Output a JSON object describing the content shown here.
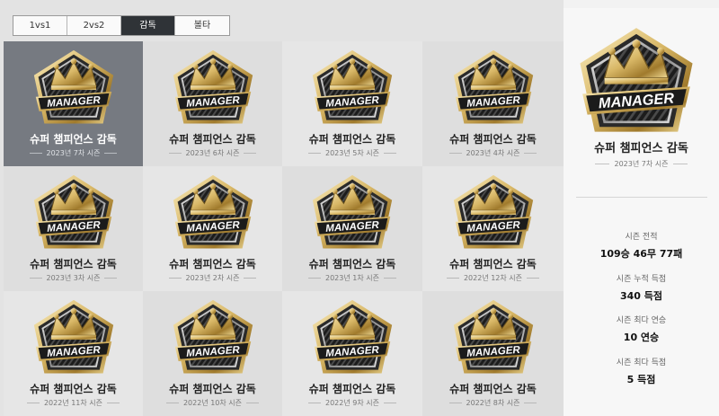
{
  "tabs": [
    {
      "label": "1vs1",
      "active": false
    },
    {
      "label": "2vs2",
      "active": false
    },
    {
      "label": "감독",
      "active": true
    },
    {
      "label": "볼타",
      "active": false
    }
  ],
  "badge": {
    "text": "MANAGER",
    "icon": "crown-icon",
    "colors": {
      "gold": "#d8b766",
      "dark": "#262626",
      "selected_bg": "#767a81"
    }
  },
  "cards": [
    {
      "title": "슈퍼 챔피언스 감독",
      "season": "2023년 7차 시즌",
      "selected": true
    },
    {
      "title": "슈퍼 챔피언스 감독",
      "season": "2023년 6차 시즌"
    },
    {
      "title": "슈퍼 챔피언스 감독",
      "season": "2023년 5차 시즌"
    },
    {
      "title": "슈퍼 챔피언스 감독",
      "season": "2023년 4차 시즌"
    },
    {
      "title": "슈퍼 챔피언스 감독",
      "season": "2023년 3차 시즌"
    },
    {
      "title": "슈퍼 챔피언스 감독",
      "season": "2023년 2차 시즌"
    },
    {
      "title": "슈퍼 챔피언스 감독",
      "season": "2023년 1차 시즌"
    },
    {
      "title": "슈퍼 챔피언스 감독",
      "season": "2022년 12차 시즌"
    },
    {
      "title": "슈퍼 챔피언스 감독",
      "season": "2022년 11차 시즌"
    },
    {
      "title": "슈퍼 챔피언스 감독",
      "season": "2022년 10차 시즌"
    },
    {
      "title": "슈퍼 챔피언스 감독",
      "season": "2022년 9차 시즌"
    },
    {
      "title": "슈퍼 챔피언스 감독",
      "season": "2022년 8차 시즌"
    }
  ],
  "detail": {
    "title": "슈퍼 챔피언스 감독",
    "season": "2023년 7차 시즌",
    "stats": [
      {
        "label": "시즌 전적",
        "value": "109승 46무 77패"
      },
      {
        "label": "시즌 누적 득점",
        "value": "340 득점"
      },
      {
        "label": "시즌 최다 연승",
        "value": "10 연승"
      },
      {
        "label": "시즌 최다 득점",
        "value": "5 득점"
      }
    ]
  }
}
